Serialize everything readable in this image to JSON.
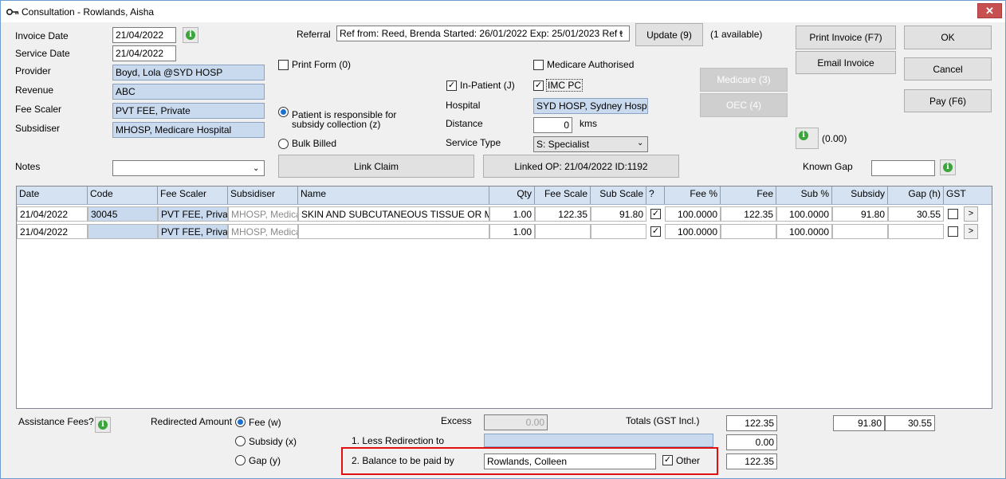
{
  "window": {
    "title": "Consultation - Rowlands, Aisha",
    "close_label": "✕"
  },
  "left_fields": {
    "invoice_date_label": "Invoice Date",
    "invoice_date": "21/04/2022",
    "service_date_label": "Service Date",
    "service_date": "21/04/2022",
    "provider_label": "Provider",
    "provider": "Boyd, Lola @SYD HOSP",
    "revenue_label": "Revenue",
    "revenue": "ABC",
    "fee_scaler_label": "Fee Scaler",
    "fee_scaler": "PVT FEE, Private",
    "subsidiser_label": "Subsidiser",
    "subsidiser": "MHOSP, Medicare Hospital",
    "notes_label": "Notes",
    "notes": ""
  },
  "referral": {
    "label": "Referral",
    "value": "Ref from: Reed, Brenda Started: 26/01/2022 Exp: 25/01/2023 Ref t",
    "update_button": "Update (9)",
    "available": "(1 available)"
  },
  "options": {
    "print_form": "Print Form (0)",
    "patient_responsible": "Patient is responsible for subsidy collection (z)",
    "bulk_billed": "Bulk Billed",
    "medicare_authorised": "Medicare Authorised",
    "in_patient": "In-Patient (J)",
    "imc_pc": "IMC PC",
    "hospital_label": "Hospital",
    "hospital": "SYD HOSP, Sydney Hospital",
    "distance_label": "Distance",
    "distance": "0",
    "distance_unit": "kms",
    "service_type_label": "Service Type",
    "service_type": "S: Specialist"
  },
  "buttons": {
    "link_claim": "Link Claim",
    "linked_op": "Linked OP: 21/04/2022 ID:1192",
    "medicare": "Medicare (3)",
    "oec": "OEC (4)",
    "print_invoice": "Print Invoice (F7)",
    "email_invoice": "Email Invoice",
    "ok": "OK",
    "cancel": "Cancel",
    "pay": "Pay (F6)",
    "info_amount": "(0.00)"
  },
  "known_gap": {
    "label": "Known Gap",
    "value": ""
  },
  "table": {
    "headers": [
      "Date",
      "Code",
      "Fee Scaler",
      "Subsidiser",
      "Name",
      "Qty",
      "Fee Scale",
      "Sub Scale",
      "?",
      "Fee %",
      "Fee",
      "Sub %",
      "Subsidy",
      "Gap (h)",
      "GST"
    ],
    "rows": [
      {
        "date": "21/04/2022",
        "code": "30045",
        "fee_scaler": "PVT FEE, Private",
        "subsidiser": "MHOSP, Medicare",
        "name": "SKIN AND SUBCUTANEOUS TISSUE OR MUCO",
        "qty": "1.00",
        "fee_scale": "122.35",
        "sub_scale": "91.80",
        "q": "✓",
        "fee_pct": "100.0000",
        "fee": "122.35",
        "sub_pct": "100.0000",
        "subsidy": "91.80",
        "gap": "30.55",
        "more": ">"
      },
      {
        "date": "21/04/2022",
        "code": "",
        "fee_scaler": "PVT FEE, Private",
        "subsidiser": "MHOSP, Medicare",
        "name": "",
        "qty": "1.00",
        "fee_scale": "",
        "sub_scale": "",
        "q": "✓",
        "fee_pct": "100.0000",
        "fee": "",
        "sub_pct": "100.0000",
        "subsidy": "",
        "gap": "",
        "more": ">"
      }
    ]
  },
  "footer": {
    "assistance_fees": "Assistance Fees?",
    "redirected_amount": "Redirected Amount",
    "fee_w": "Fee (w)",
    "subsidy_x": "Subsidy (x)",
    "gap_y": "Gap (y)",
    "excess_label": "Excess",
    "excess": "0.00",
    "less_redirection": "1. Less Redirection to",
    "balance_label": "2. Balance to be paid by",
    "balance_payer": "Rowlands, Colleen",
    "other_label": "Other",
    "totals_label": "Totals (GST Incl.)",
    "total_fee": "122.35",
    "total_subsidy": "91.80",
    "total_gap": "30.55",
    "less_redirection_value": "0.00",
    "balance_value": "122.35"
  },
  "colors": {
    "field_blue": "#c9d9ee",
    "highlight_red": "#e01010",
    "title_bg": "#ffffff"
  }
}
